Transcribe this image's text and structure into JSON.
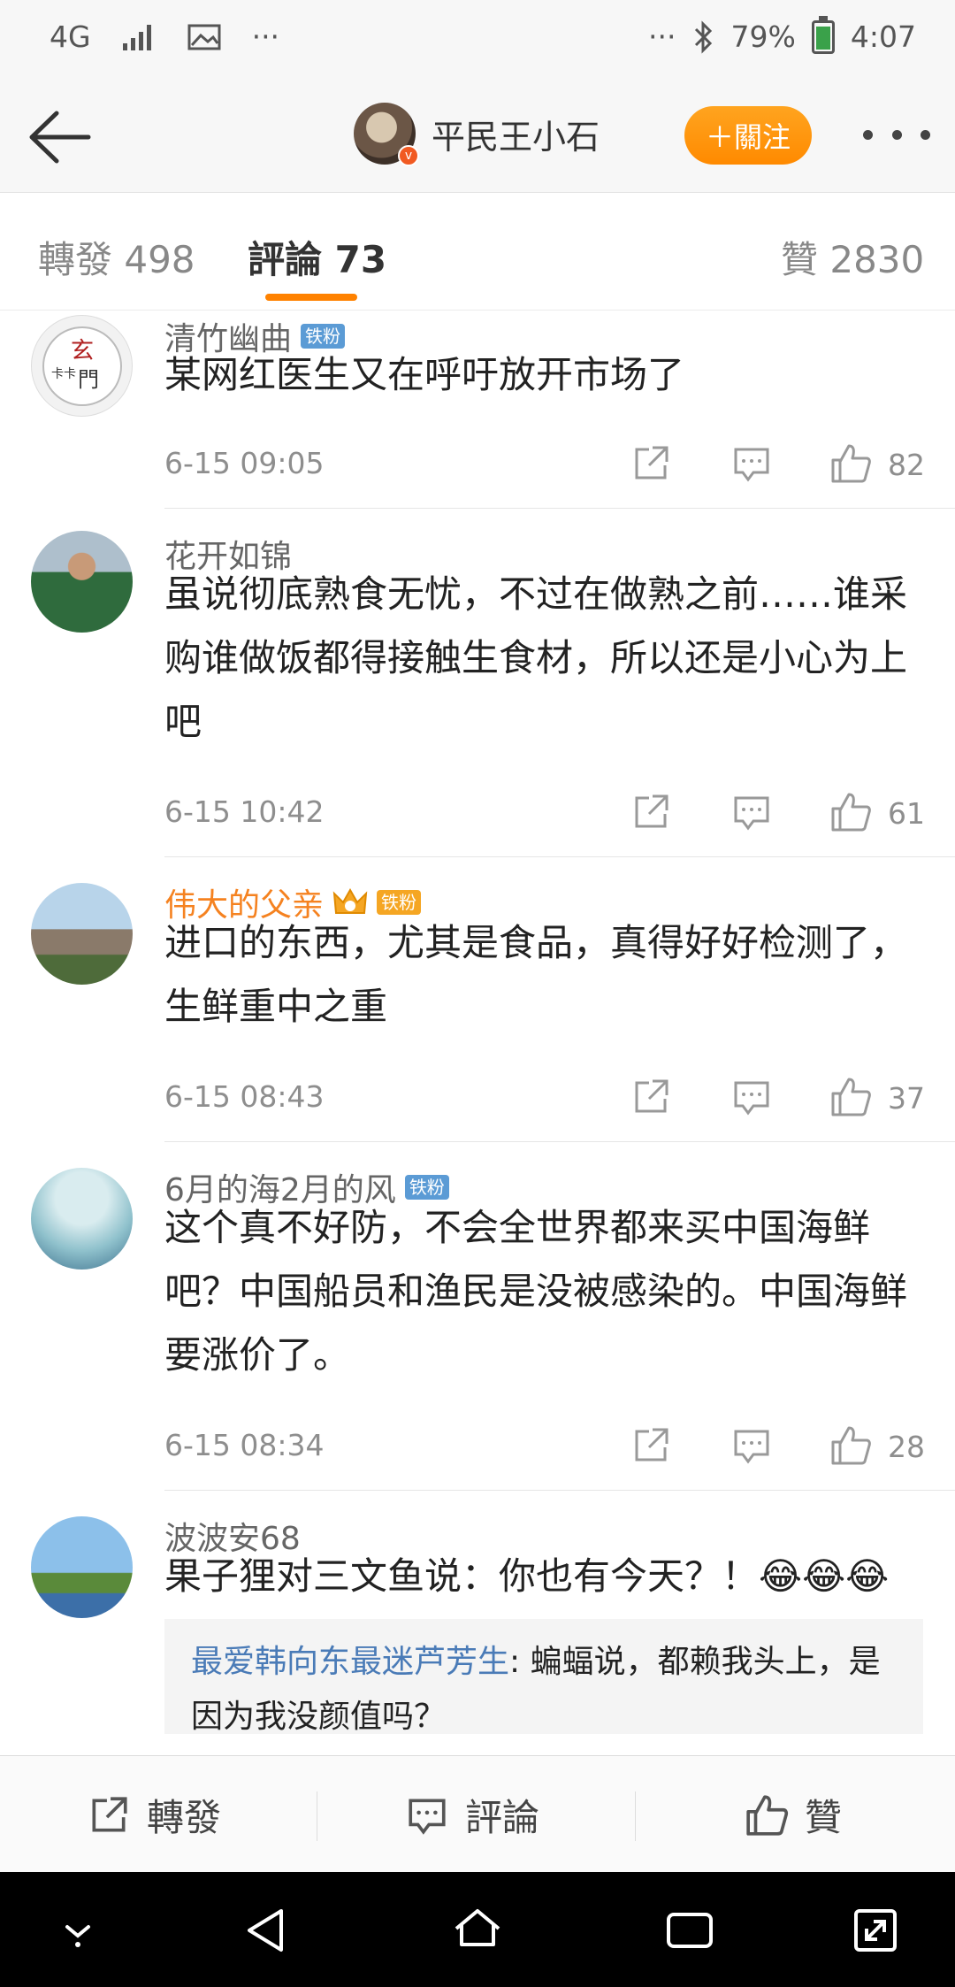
{
  "status_bar": {
    "network": "4G",
    "extra": "···",
    "more": "···",
    "battery": "79%",
    "battery_level": 0.79,
    "time": "4:07"
  },
  "header": {
    "username": "平民王小石",
    "follow_label": "＋關注",
    "icons": [
      "back-arrow-icon",
      "verified-badge-icon",
      "more-icon"
    ]
  },
  "tabs": [
    {
      "label": "轉發 498"
    },
    {
      "label": "評論 73",
      "active": true
    },
    {
      "label": "贊 2830"
    }
  ],
  "comments": [
    {
      "name": "清竹幽曲",
      "badge": "铁粉",
      "text": "某网红医生又在呼吁放开市场了",
      "time": "6-15 09:05",
      "likes": "82",
      "avatar_text": "玄門",
      "avatar_text2": "卡卡"
    },
    {
      "name": "花开如锦",
      "text": "虽说彻底熟食无忧，不过在做熟之前……谁采购谁做饭都得接触生食材，所以还是小心为上吧",
      "time": "6-15 10:42",
      "likes": "61"
    },
    {
      "name": "伟大的父亲",
      "badge": "铁粉",
      "vip": true,
      "text": "进口的东西，尤其是食品，真得好好检测了，生鲜重中之重",
      "time": "6-15 08:43",
      "likes": "37"
    },
    {
      "name": "6月的海2月的风",
      "badge": "铁粉",
      "text": "这个真不好防，不会全世界都来买中国海鲜吧？中国船员和渔民是没被感染的。中国海鲜要涨价了。",
      "time": "6-15 08:34",
      "likes": "28"
    },
    {
      "name": "波波安68",
      "text": "果子狸对三文鱼说：你也有今天？！",
      "emoji": "😂😂😂",
      "reply": {
        "author": "最爱韩向东最迷芦芳生",
        "text": ": 蝙蝠说，都赖我头上，是因为我没颜值吗？"
      }
    }
  ],
  "action_bar": {
    "repost_label": "轉發",
    "comment_label": "評論",
    "like_label": "贊"
  },
  "colors": {
    "accent": "#ff8200",
    "gold_name": "#f58220",
    "fan_badge": "#5b9bd5",
    "reply_author": "#4a7bb7"
  }
}
